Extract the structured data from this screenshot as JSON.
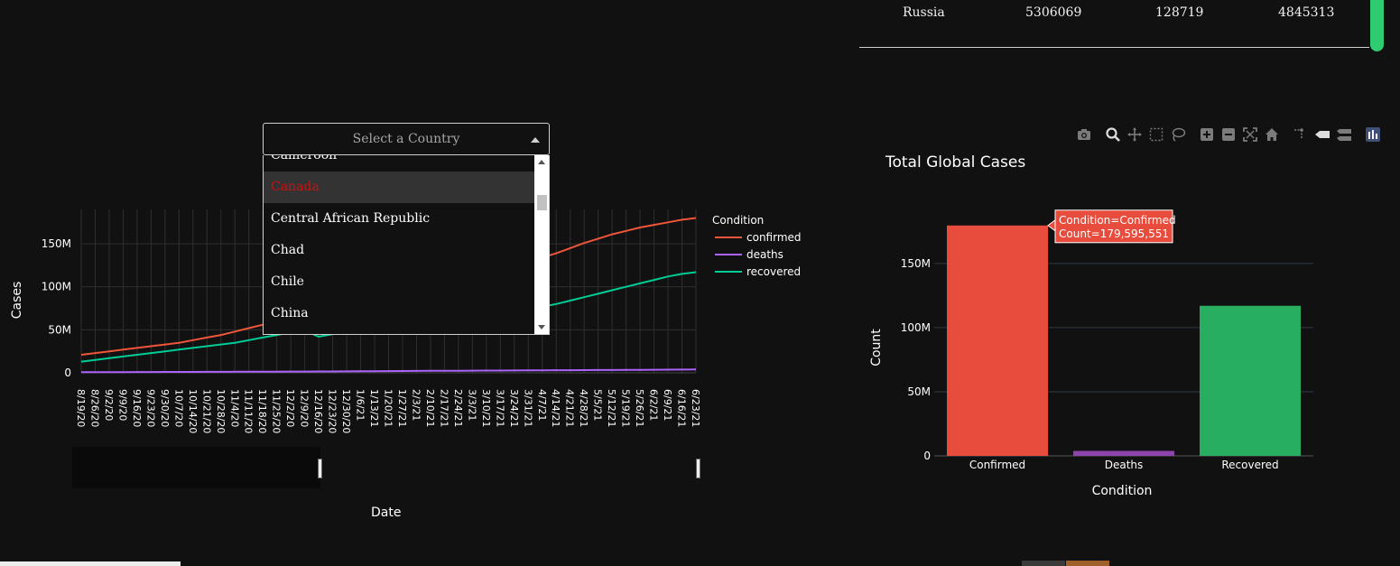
{
  "table": {
    "row": {
      "country": "Russia",
      "confirmed": "5306069",
      "deaths": "128719",
      "recovered": "4845313"
    }
  },
  "dropdown": {
    "placeholder": "Select a Country",
    "options": [
      "Cameroon",
      "Canada",
      "Central African Republic",
      "Chad",
      "Chile",
      "China"
    ],
    "highlighted": "Canada"
  },
  "modebar": {
    "icons": [
      "camera-icon",
      "zoom-icon",
      "pan-icon",
      "box-select-icon",
      "lasso-select-icon",
      "zoom-in-icon",
      "zoom-out-icon",
      "autoscale-icon",
      "reset-axes-icon",
      "spike-lines-icon",
      "hover-closest-icon",
      "hover-compare-icon",
      "plotly-logo-icon"
    ]
  },
  "colors": {
    "confirmed": "#ef553b",
    "deaths": "#ab63fa",
    "recovered": "#00cc96",
    "bar_confirmed": "#e74c3c",
    "bar_deaths": "#8e44ad",
    "bar_recovered": "#27ae60",
    "tooltip": "#e74c3c"
  },
  "chart_data": [
    {
      "type": "line",
      "title": "",
      "xlabel": "Date",
      "ylabel": "Cases",
      "legend_title": "Condition",
      "legend_placement": "right",
      "grid": true,
      "ylim": [
        0,
        190000000
      ],
      "y_ticks": [
        0,
        50000000,
        100000000,
        150000000
      ],
      "y_tick_labels": [
        "0",
        "50M",
        "100M",
        "150M"
      ],
      "x_tick_labels": [
        "8/19/20",
        "8/26/20",
        "9/2/20",
        "9/9/20",
        "9/16/20",
        "9/23/20",
        "9/30/20",
        "10/7/20",
        "10/14/20",
        "10/21/20",
        "10/28/20",
        "11/4/20",
        "11/11/20",
        "11/18/20",
        "11/25/20",
        "12/2/20",
        "12/9/20",
        "12/16/20",
        "12/23/20",
        "12/30/20",
        "1/6/21",
        "1/13/21",
        "1/20/21",
        "1/27/21",
        "2/3/21",
        "2/10/21",
        "2/17/21",
        "2/24/21",
        "3/3/21",
        "3/10/21",
        "3/17/21",
        "3/24/21",
        "3/31/21",
        "4/7/21",
        "4/14/21",
        "4/21/21",
        "4/28/21",
        "5/5/21",
        "5/12/21",
        "5/19/21",
        "5/26/21",
        "6/2/21",
        "6/9/21",
        "6/16/21",
        "6/23/21"
      ],
      "x": [
        "8/19/20",
        "8/26/20",
        "9/2/20",
        "9/9/20",
        "9/16/20",
        "9/23/20",
        "9/30/20",
        "10/7/20",
        "10/14/20",
        "10/21/20",
        "10/28/20",
        "11/4/20",
        "11/11/20",
        "11/18/20",
        "11/25/20",
        "12/2/20",
        "12/9/20",
        "12/16/20",
        "12/23/20",
        "12/30/20",
        "1/6/21",
        "1/13/21",
        "1/20/21",
        "1/27/21",
        "2/3/21",
        "2/10/21",
        "2/17/21",
        "2/24/21",
        "3/3/21",
        "3/10/21",
        "3/17/21",
        "3/24/21",
        "3/31/21",
        "4/7/21",
        "4/14/21",
        "4/21/21",
        "4/28/21",
        "5/5/21",
        "5/12/21",
        "5/19/21",
        "5/26/21",
        "6/2/21",
        "6/9/21",
        "6/16/21",
        "6/23/21"
      ],
      "series": [
        {
          "name": "confirmed",
          "values": [
            21000000,
            23000000,
            25000000,
            27000000,
            29000000,
            31000000,
            33000000,
            35000000,
            38000000,
            41000000,
            44000000,
            48000000,
            52000000,
            56000000,
            60000000,
            64000000,
            68000000,
            72000000,
            76000000,
            80000000,
            84000000,
            88000000,
            91000000,
            95000000,
            98000000,
            101000000,
            104000000,
            107000000,
            111000000,
            115000000,
            119000000,
            124000000,
            129000000,
            134000000,
            139000000,
            145000000,
            151000000,
            156000000,
            161000000,
            165000000,
            169000000,
            172000000,
            175000000,
            178000000,
            180000000
          ]
        },
        {
          "name": "deaths",
          "values": [
            700000,
            750000,
            800000,
            850000,
            900000,
            950000,
            1000000,
            1050000,
            1100000,
            1150000,
            1200000,
            1250000,
            1300000,
            1350000,
            1400000,
            1450000,
            1500000,
            1550000,
            1600000,
            1700000,
            1800000,
            1900000,
            2000000,
            2100000,
            2200000,
            2300000,
            2350000,
            2400000,
            2500000,
            2600000,
            2650000,
            2700000,
            2800000,
            2900000,
            3000000,
            3050000,
            3150000,
            3250000,
            3300000,
            3400000,
            3500000,
            3600000,
            3700000,
            3800000,
            3900000
          ]
        },
        {
          "name": "recovered",
          "values": [
            13000000,
            15000000,
            17000000,
            19000000,
            21000000,
            23000000,
            25000000,
            27000000,
            29000000,
            31000000,
            33000000,
            35000000,
            38000000,
            41000000,
            44000000,
            47000000,
            49000000,
            42000000,
            45000000,
            47000000,
            49000000,
            51000000,
            53000000,
            55000000,
            57000000,
            59000000,
            61000000,
            63000000,
            65000000,
            67000000,
            69000000,
            71000000,
            74000000,
            77000000,
            80000000,
            84000000,
            88000000,
            92000000,
            96000000,
            100000000,
            104000000,
            108000000,
            112000000,
            115000000,
            117000000
          ]
        }
      ]
    },
    {
      "type": "bar",
      "title": "Total Global Cases",
      "xlabel": "Condition",
      "ylabel": "Count",
      "grid": true,
      "categories": [
        "Confirmed",
        "Deaths",
        "Recovered"
      ],
      "values": [
        179595551,
        3890000,
        117000000
      ],
      "ylim": [
        0,
        190000000
      ],
      "y_ticks": [
        0,
        50000000,
        100000000,
        150000000
      ],
      "y_tick_labels": [
        "0",
        "50M",
        "100M",
        "150M"
      ],
      "tooltip": {
        "line1": "Condition=Confirmed",
        "line2": "Count=179,595,551"
      }
    }
  ]
}
